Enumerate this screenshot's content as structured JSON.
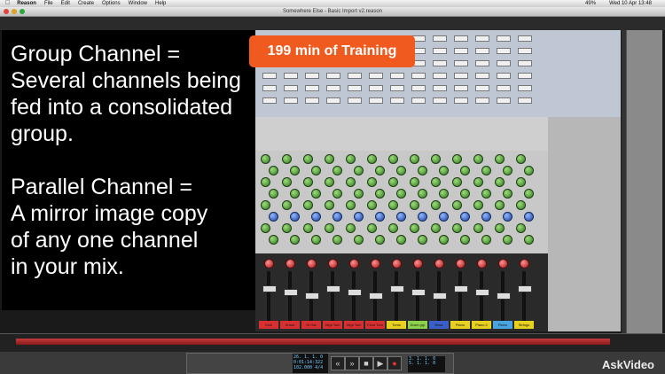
{
  "menubar": {
    "app": "Reason",
    "items": [
      "File",
      "Edit",
      "Create",
      "Options",
      "Window",
      "Help"
    ],
    "battery": "49%",
    "clock": "Wed 10 Apr 13:48"
  },
  "window": {
    "title": "Somewhere Else - Basic Import v2.reason"
  },
  "overlay": {
    "group_line1": "Group Channel =",
    "group_line2": "Several channels being",
    "group_line3": "fed into a consolidated",
    "group_line4": "group.",
    "parallel_line1": "Parallel Channel =",
    "parallel_line2": "A mirror image copy",
    "parallel_line3": "of any one channel",
    "parallel_line4": "in your mix."
  },
  "badge": {
    "label": "199 min of Training"
  },
  "channels": [
    {
      "name": "Kick",
      "color": "#d83030"
    },
    {
      "name": "Snare",
      "color": "#d83030"
    },
    {
      "name": "Hi Hat",
      "color": "#d83030"
    },
    {
      "name": "High Tom",
      "color": "#d83030"
    },
    {
      "name": "High Tom",
      "color": "#d83030"
    },
    {
      "name": "Floor Tom",
      "color": "#d83030"
    },
    {
      "name": "Toms",
      "color": "#e8d020"
    },
    {
      "name": "Drum grp",
      "color": "#8cd24a"
    },
    {
      "name": "Bass",
      "color": "#3a5fc8"
    },
    {
      "name": "Piano",
      "color": "#e8d020"
    },
    {
      "name": "Piano 2",
      "color": "#e8d020"
    },
    {
      "name": "Piano",
      "color": "#4aa4e0"
    },
    {
      "name": "Strings",
      "color": "#e8d020"
    },
    {
      "name": "Gtr 1",
      "color": "#d83030"
    }
  ],
  "transport": {
    "position": "26. 1. 1. 0",
    "time": "0:01:14:322",
    "tempo": "102.000",
    "signature": "4/4",
    "loop_left": "3. 1. 1. 0",
    "loop_right": "5. 1. 1. 0"
  },
  "watermark": {
    "text": "AskVideo"
  }
}
